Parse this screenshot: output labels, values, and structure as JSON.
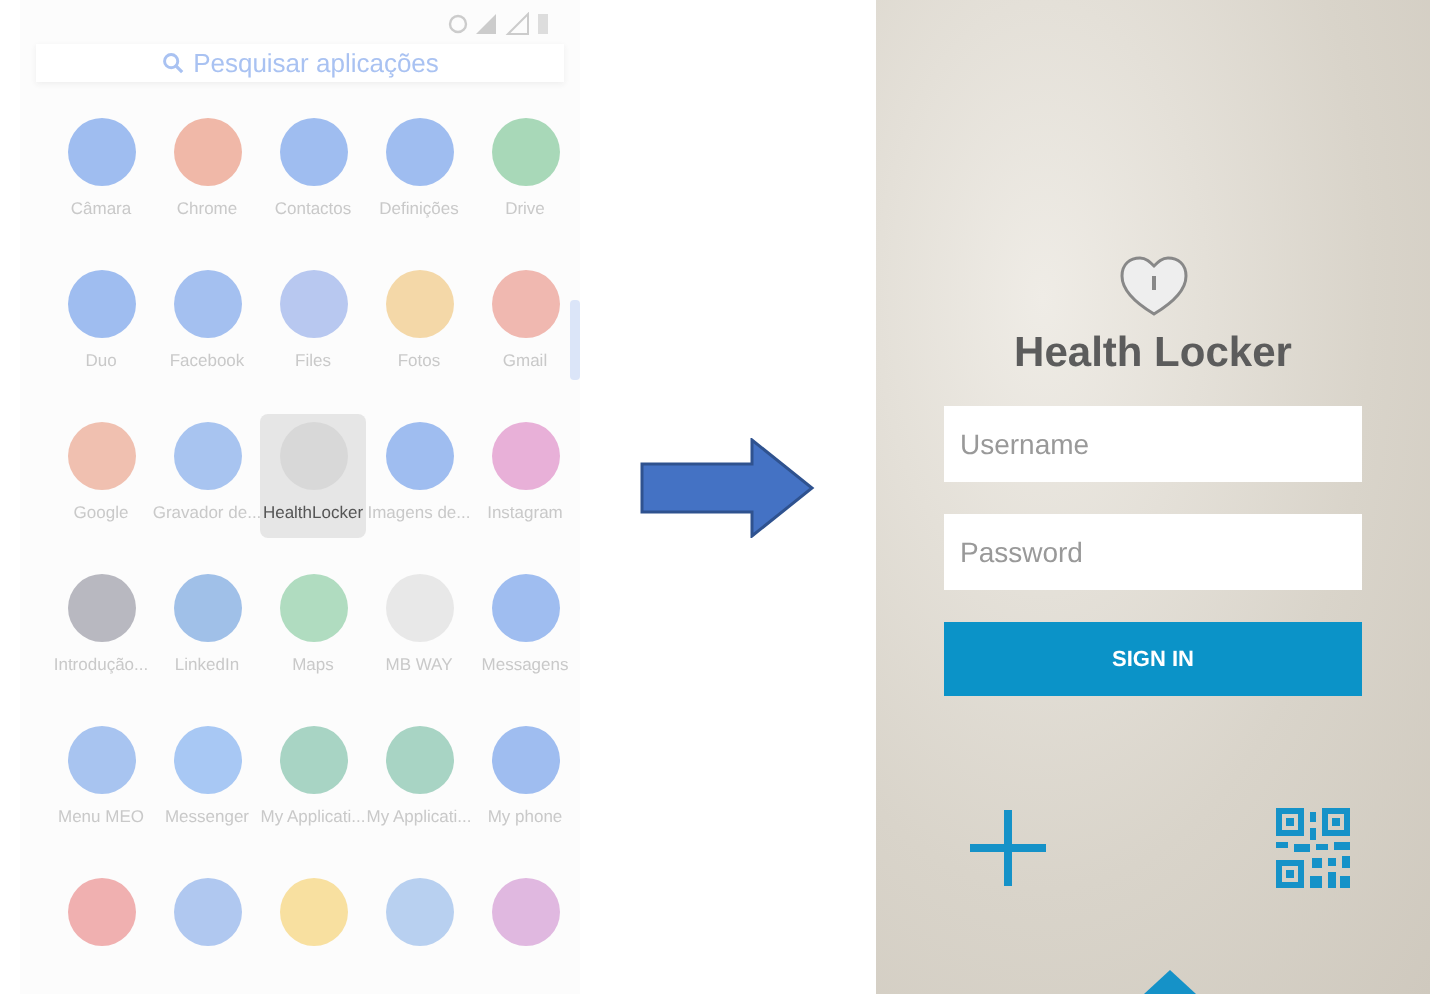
{
  "app_drawer": {
    "search": {
      "placeholder": "Pesquisar aplicações"
    },
    "apps": [
      {
        "label": "Câmara",
        "color": "#9fbdf0",
        "selected": false
      },
      {
        "label": "Chrome",
        "color": "#f0b8a8",
        "selected": false
      },
      {
        "label": "Contactos",
        "color": "#9fbdf0",
        "selected": false
      },
      {
        "label": "Definições",
        "color": "#9fbdf0",
        "selected": false
      },
      {
        "label": "Drive",
        "color": "#a8d8b8",
        "selected": false
      },
      {
        "label": "Duo",
        "color": "#9fbdf0",
        "selected": false
      },
      {
        "label": "Facebook",
        "color": "#a4c0f0",
        "selected": false
      },
      {
        "label": "Files",
        "color": "#b8c8f0",
        "selected": false
      },
      {
        "label": "Fotos",
        "color": "#f4d8a8",
        "selected": false
      },
      {
        "label": "Gmail",
        "color": "#f0b8b0",
        "selected": false
      },
      {
        "label": "Google",
        "color": "#f0c0b0",
        "selected": false
      },
      {
        "label": "Gravador de...",
        "color": "#a8c4f0",
        "selected": false
      },
      {
        "label": "HealthLocker",
        "color": "#d8d8d8",
        "selected": true
      },
      {
        "label": "Imagens de...",
        "color": "#9fbdf0",
        "selected": false
      },
      {
        "label": "Instagram",
        "color": "#e8b0d8",
        "selected": false
      },
      {
        "label": "Introdução...",
        "color": "#b8b8c0",
        "selected": false
      },
      {
        "label": "LinkedIn",
        "color": "#a0c0e8",
        "selected": false
      },
      {
        "label": "Maps",
        "color": "#b0dcc0",
        "selected": false
      },
      {
        "label": "MB WAY",
        "color": "#e8e8e8",
        "selected": false
      },
      {
        "label": "Messagens",
        "color": "#9fbdf0",
        "selected": false
      },
      {
        "label": "Menu MEO",
        "color": "#a8c4f0",
        "selected": false
      },
      {
        "label": "Messenger",
        "color": "#a8c8f4",
        "selected": false
      },
      {
        "label": "My Applicati...",
        "color": "#a8d4c4",
        "selected": false
      },
      {
        "label": "My Applicati...",
        "color": "#a8d4c4",
        "selected": false
      },
      {
        "label": "My phone",
        "color": "#9fbdf0",
        "selected": false
      },
      {
        "color": "#f0b0b0",
        "selected": false
      },
      {
        "color": "#b0c8f0",
        "selected": false
      },
      {
        "color": "#f8e0a0",
        "selected": false
      },
      {
        "color": "#b8d0f0",
        "selected": false
      },
      {
        "color": "#e0b8e0",
        "selected": false
      }
    ]
  },
  "login": {
    "title": "Health Locker",
    "username": {
      "placeholder": "Username"
    },
    "password": {
      "placeholder": "Password"
    },
    "sign_in": "SIGN IN"
  }
}
